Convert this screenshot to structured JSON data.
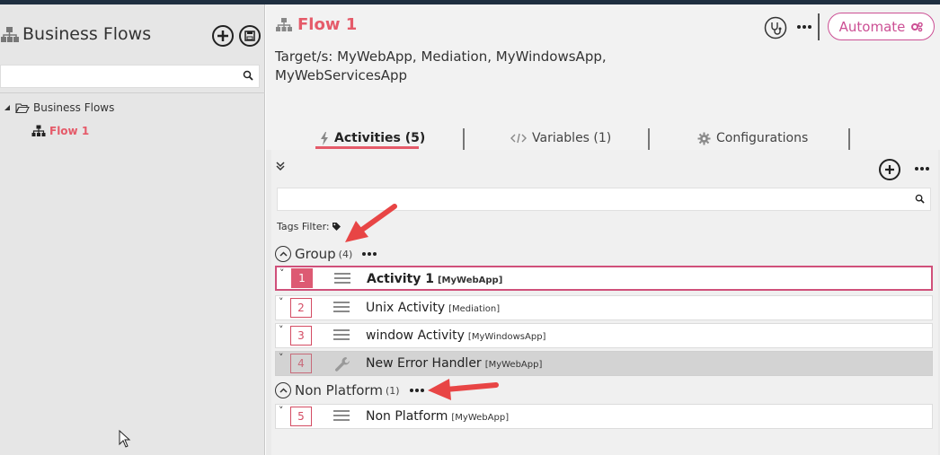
{
  "sidebar": {
    "title": "Business Flows",
    "add_icon": "plus-circle-icon",
    "save_icon": "save-icon",
    "search_placeholder": "",
    "tree": {
      "root_label": "Business Flows",
      "child_label": "Flow 1"
    }
  },
  "flow": {
    "title": "Flow 1",
    "target": "Target/s: MyWebApp, Mediation, MyWindowsApp, MyWebServicesApp",
    "automate_label": "Automate"
  },
  "tabs": [
    {
      "label": "Activities (5)",
      "icon": "bolt-icon",
      "active": true
    },
    {
      "label": "Variables (1)",
      "icon": "code-icon",
      "active": false
    },
    {
      "label": "Configurations",
      "icon": "gear-icon",
      "active": false
    }
  ],
  "activities": {
    "search_placeholder": "",
    "tags_filter_label": "Tags Filter:",
    "groups": [
      {
        "name": "Group",
        "count": "(4)",
        "rows": [
          {
            "num": "1",
            "name": "Activity 1",
            "target": "[MyWebApp]",
            "selected": true,
            "kind": "activity"
          },
          {
            "num": "2",
            "name": "Unix Activity",
            "target": "[Mediation]",
            "selected": false,
            "kind": "activity"
          },
          {
            "num": "3",
            "name": "window Activity",
            "target": "[MyWindowsApp]",
            "selected": false,
            "kind": "activity"
          },
          {
            "num": "4",
            "name": "New Error Handler",
            "target": "[MyWebApp]",
            "selected": false,
            "kind": "error-handler"
          }
        ]
      },
      {
        "name": "Non Platform",
        "count": "(1)",
        "rows": [
          {
            "num": "5",
            "name": "Non Platform",
            "target": "[MyWebApp]",
            "selected": false,
            "kind": "activity"
          }
        ]
      }
    ]
  },
  "colors": {
    "accent": "#e55a69",
    "automate": "#cc4f94",
    "annotation_arrow": "#e84545"
  }
}
